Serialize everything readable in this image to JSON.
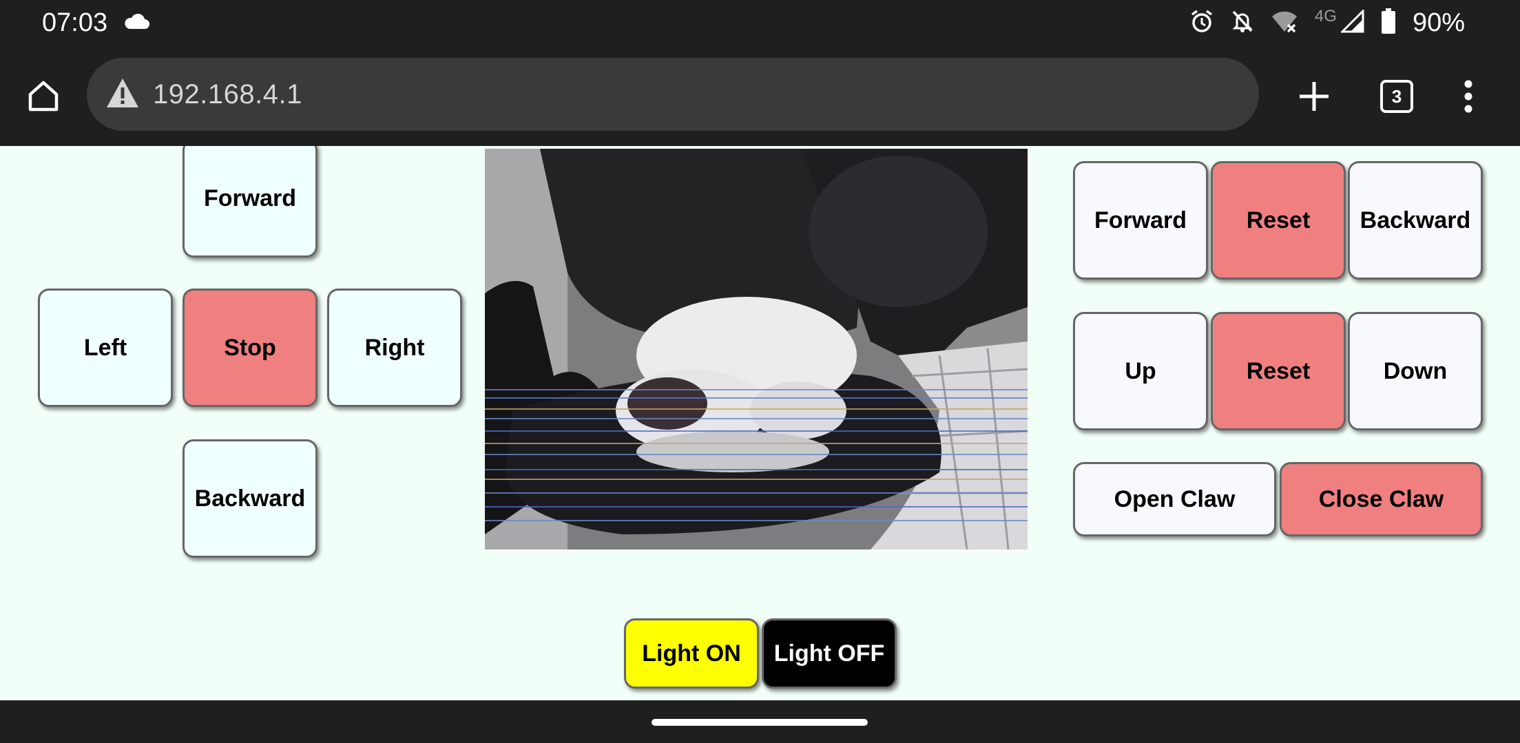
{
  "status_bar": {
    "time": "07:03",
    "icons_left": [
      "cloud-icon"
    ],
    "icons_right": [
      "alarm-icon",
      "notifications-off-icon",
      "wifi-off-icon",
      "signal-icon",
      "battery-icon"
    ],
    "network_type": "4G",
    "battery_percent": "90%"
  },
  "browser": {
    "url": "192.168.4.1",
    "tab_count": "3",
    "icons": [
      "home-icon",
      "warning-icon",
      "plus-icon",
      "tabs-icon",
      "more-vert-icon"
    ]
  },
  "drive_pad": {
    "forward": "Forward",
    "left": "Left",
    "stop": "Stop",
    "right": "Right",
    "backward": "Backward"
  },
  "camera": {
    "label": "camera-feed"
  },
  "arm_controls": {
    "row1": {
      "forward": "Forward",
      "reset": "Reset",
      "backward": "Backward"
    },
    "row2": {
      "up": "Up",
      "reset": "Reset",
      "down": "Down"
    },
    "row3": {
      "open_claw": "Open Claw",
      "close_claw": "Close Claw"
    }
  },
  "light": {
    "on": "Light ON",
    "off": "Light OFF"
  },
  "colors": {
    "chrome_bg": "#1f1f1f",
    "omnibox_bg": "#3a3a3a",
    "page_bg": "#f2fff8",
    "drive_button": "#f0ffff",
    "arm_button": "#f8f8ff",
    "stop_reset_button": "#f08080",
    "light_on": "#ffff00",
    "light_off": "#000000"
  }
}
